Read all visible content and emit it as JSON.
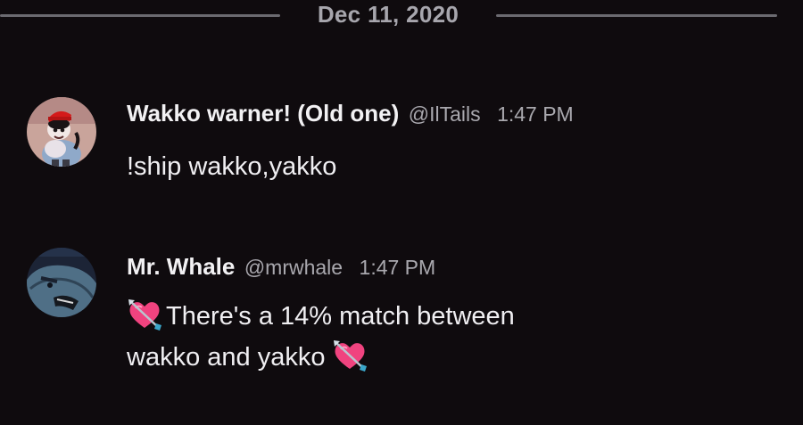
{
  "date_divider": {
    "label": "Dec 11, 2020"
  },
  "messages": [
    {
      "username": "Wakko warner! (Old one)",
      "handle": "@IlTails",
      "time": "1:47 PM",
      "avatar_icon": "cartoon-avatar-icon",
      "text_line1": "!ship wakko,yakko"
    },
    {
      "username": "Mr. Whale",
      "handle": "@mrwhale",
      "time": "1:47 PM",
      "avatar_icon": "whale-avatar-icon",
      "emoji_icon": "heart-with-arrow-emoji-icon",
      "text_line1": "There's a 14% match between",
      "text_line2": "wakko and yakko"
    }
  ],
  "colors": {
    "background": "#0f0b0e",
    "username": "#f2f1f3",
    "meta_text": "#a9a8ae",
    "divider": "#6b6a70"
  }
}
